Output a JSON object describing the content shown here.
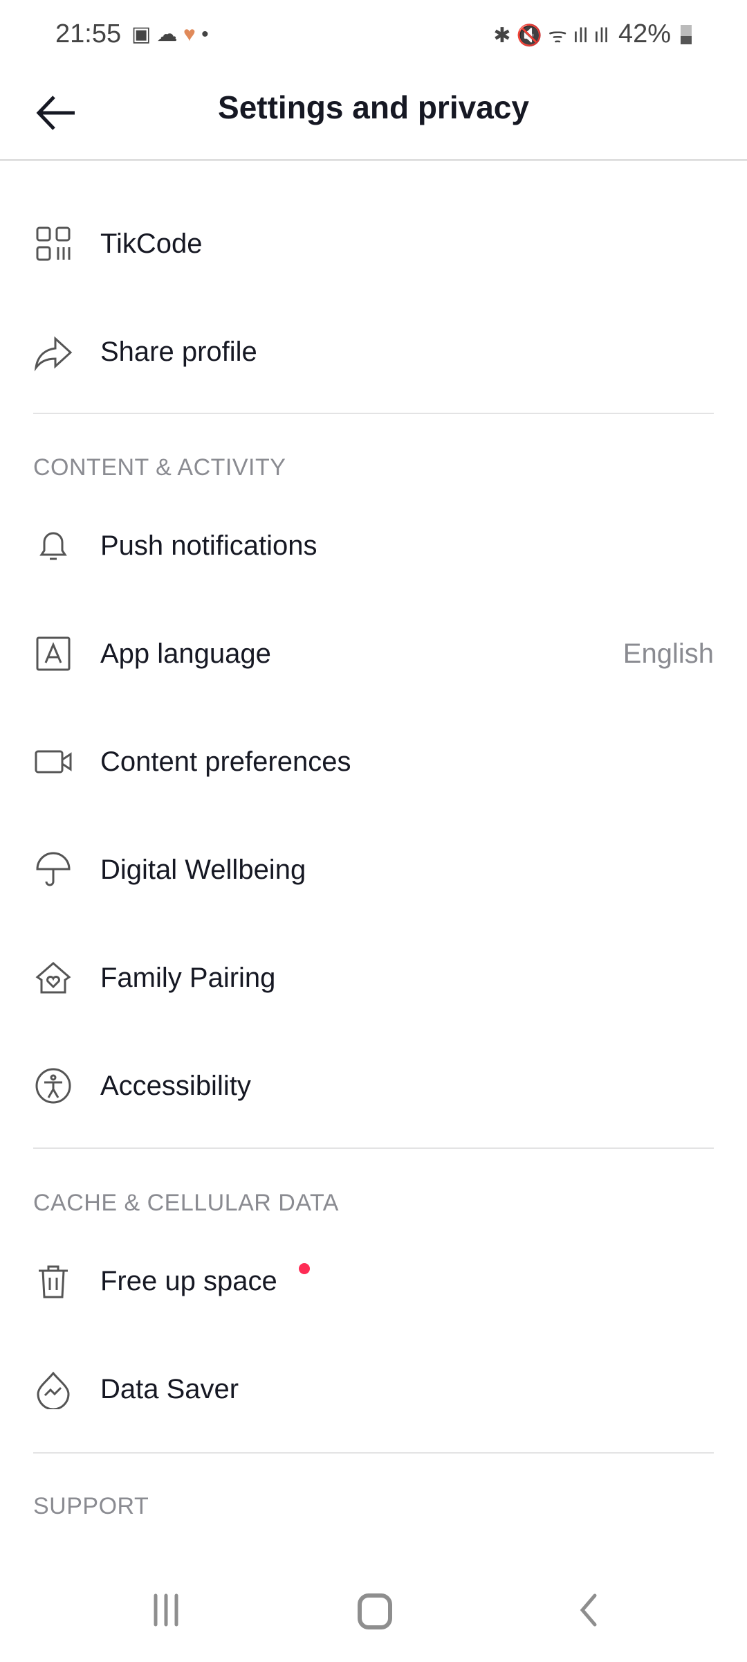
{
  "status_bar": {
    "time": "21:55",
    "battery": "42%",
    "battery_level": 0.42
  },
  "header": {
    "title": "Settings and privacy"
  },
  "top_items": [
    {
      "label": "TikCode",
      "icon": "qr-code-icon"
    },
    {
      "label": "Share profile",
      "icon": "share-icon"
    }
  ],
  "sections": [
    {
      "title": "CONTENT & ACTIVITY",
      "items": [
        {
          "label": "Push notifications",
          "icon": "bell-icon"
        },
        {
          "label": "App language",
          "value": "English",
          "icon": "language-icon"
        },
        {
          "label": "Content preferences",
          "icon": "video-icon"
        },
        {
          "label": "Digital Wellbeing",
          "icon": "umbrella-icon"
        },
        {
          "label": "Family Pairing",
          "icon": "house-heart-icon"
        },
        {
          "label": "Accessibility",
          "icon": "accessibility-icon"
        }
      ]
    },
    {
      "title": "CACHE & CELLULAR DATA",
      "items": [
        {
          "label": "Free up space",
          "icon": "trash-icon",
          "badge_color": "#fe2c55"
        },
        {
          "label": "Data Saver",
          "icon": "data-saver-icon"
        }
      ]
    },
    {
      "title": "SUPPORT",
      "items": []
    }
  ]
}
